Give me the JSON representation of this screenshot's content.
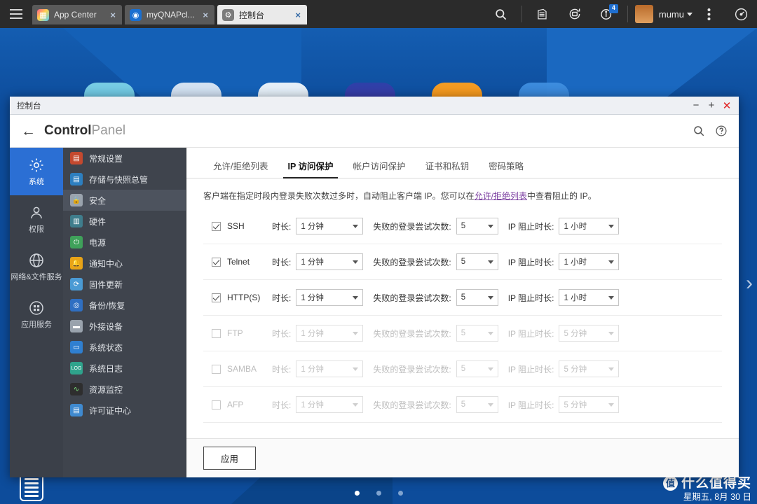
{
  "topbar": {
    "menu_icon": "hamburger-icon",
    "tabs": [
      {
        "label": "App Center",
        "icon": "app-center-icon",
        "close": "×",
        "active": false
      },
      {
        "label": "myQNAPcl...",
        "icon": "myqnapcloud-icon",
        "close": "×",
        "active": false
      },
      {
        "label": "控制台",
        "icon": "gear-icon",
        "close": "×",
        "active": true
      }
    ],
    "icons": [
      {
        "name": "search-icon",
        "glyph": "⌕"
      },
      {
        "name": "file-station-icon",
        "glyph": "☰"
      },
      {
        "name": "backup-sync-icon",
        "glyph": "⟳"
      },
      {
        "name": "info-icon",
        "glyph": "i",
        "badge": "4"
      }
    ],
    "user": "mumu",
    "more_icon": "more-vertical-icon",
    "dashboard_icon": "dashboard-icon"
  },
  "window": {
    "title": "控制台",
    "minimize": "−",
    "maximize": "+",
    "close": "✕",
    "header": {
      "back": "←",
      "title_bold": "Control",
      "title_light": "Panel",
      "search_icon": "search-icon",
      "help_icon": "help-icon"
    }
  },
  "rail": [
    {
      "label": "系统",
      "icon": "gear-icon",
      "active": true
    },
    {
      "label": "权限",
      "icon": "user-icon",
      "active": false
    },
    {
      "label": "网络&文件服务",
      "icon": "globe-icon",
      "active": false
    },
    {
      "label": "应用服务",
      "icon": "grid-icon",
      "active": false
    }
  ],
  "menu": [
    {
      "label": "常规设置",
      "icon": "clipboard-icon",
      "color": "#c4492f",
      "active": false
    },
    {
      "label": "存储与快照总管",
      "icon": "storage-icon",
      "color": "#2d7fc0",
      "active": false
    },
    {
      "label": "安全",
      "icon": "lock-icon",
      "color": "#9aa3ad",
      "active": true
    },
    {
      "label": "硬件",
      "icon": "hardware-icon",
      "color": "#3f7d8c",
      "active": false
    },
    {
      "label": "电源",
      "icon": "power-icon",
      "color": "#3fa15a",
      "active": false
    },
    {
      "label": "通知中心",
      "icon": "bell-icon",
      "color": "#e8a317",
      "active": false
    },
    {
      "label": "固件更新",
      "icon": "firmware-icon",
      "color": "#4a9ad4",
      "active": false
    },
    {
      "label": "备份/恢复",
      "icon": "backup-icon",
      "color": "#2f6fc2",
      "active": false
    },
    {
      "label": "外接设备",
      "icon": "external-device-icon",
      "color": "#9aa3ad",
      "active": false
    },
    {
      "label": "系统状态",
      "icon": "monitor-icon",
      "color": "#2f7fd0",
      "active": false
    },
    {
      "label": "系统日志",
      "icon": "log-icon",
      "color": "#2fa38c",
      "active": false
    },
    {
      "label": "资源监控",
      "icon": "chart-icon",
      "color": "#2e2e2e",
      "active": false
    },
    {
      "label": "许可证中心",
      "icon": "license-icon",
      "color": "#3f8ad0",
      "active": false
    }
  ],
  "content": {
    "tabs": [
      {
        "label": "允许/拒绝列表",
        "active": false
      },
      {
        "label": "IP 访问保护",
        "active": true
      },
      {
        "label": "帐户访问保护",
        "active": false
      },
      {
        "label": "证书和私钥",
        "active": false
      },
      {
        "label": "密码策略",
        "active": false
      }
    ],
    "description_before": "客户端在指定时段内登录失败次数过多时，自动阻止客户端 IP。您可以在",
    "description_link": "允许/拒绝列表",
    "description_after": "中查看阻止的 IP。",
    "labels": {
      "duration": "时长:",
      "attempts": "失败的登录尝试次数:",
      "block": "IP 阻止时长:"
    },
    "rows": [
      {
        "service": "SSH",
        "enabled": true,
        "duration": "1 分钟",
        "attempts": "5",
        "block": "1 小时"
      },
      {
        "service": "Telnet",
        "enabled": true,
        "duration": "1 分钟",
        "attempts": "5",
        "block": "1 小时"
      },
      {
        "service": "HTTP(S)",
        "enabled": true,
        "duration": "1 分钟",
        "attempts": "5",
        "block": "1 小时"
      },
      {
        "service": "FTP",
        "enabled": false,
        "duration": "1 分钟",
        "attempts": "5",
        "block": "5 分钟"
      },
      {
        "service": "SAMBA",
        "enabled": false,
        "duration": "1 分钟",
        "attempts": "5",
        "block": "5 分钟"
      },
      {
        "service": "AFP",
        "enabled": false,
        "duration": "1 分钟",
        "attempts": "5",
        "block": "5 分钟"
      }
    ],
    "apply_label": "应用",
    "highlight_color": "#e01b1b"
  },
  "desktop": {
    "edge_chevron": "›",
    "dock_icon": "list-icon",
    "page_dots": [
      true,
      false,
      false
    ],
    "watermark_badge": "值",
    "watermark_text": "什么值得买",
    "watermark_date": "星期五, 8月 30 日"
  }
}
